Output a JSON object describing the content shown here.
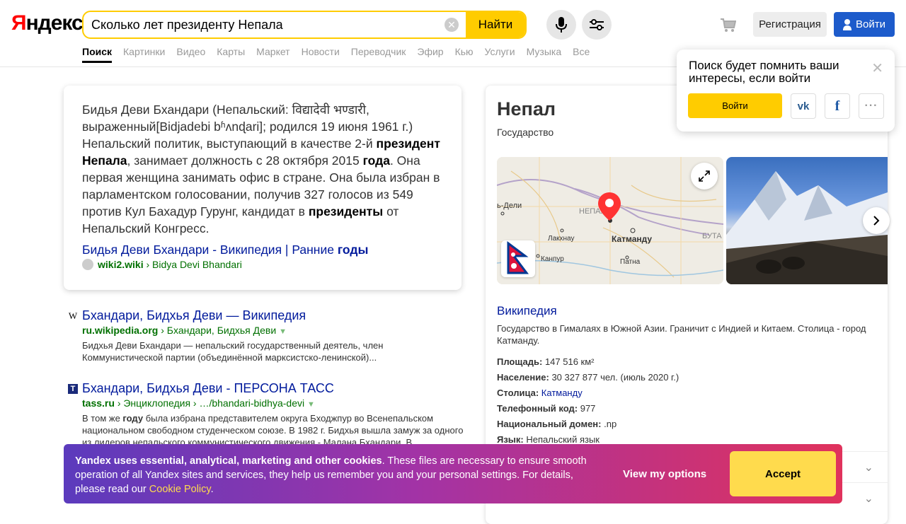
{
  "header": {
    "logo_ya": "Я",
    "logo_rest": "ндекс",
    "search_value": "Сколько лет президенту Непала",
    "find_label": "Найти",
    "register_label": "Регистрация",
    "login_label": "Войти"
  },
  "tabs": [
    "Поиск",
    "Картинки",
    "Видео",
    "Карты",
    "Маркет",
    "Новости",
    "Переводчик",
    "Эфир",
    "Кью",
    "Услуги",
    "Музыка",
    "Все"
  ],
  "snippet": {
    "text_1": "Бидья Деви Бхандари (Непальский: विद्यादेवी भण्डारी, выраженный[Bidjadebi bʱʌnɖari]; родился 19 июня 1961 г.) Непальский политик, выступающий в качестве 2-й ",
    "bold_1": "президент Непала",
    "text_2": ", занимает должность с 28 октября 2015 ",
    "bold_2": "года",
    "text_3": ". Она первая женщина занимать офис в стране. Она была избран в парламентском голосовании, получив 327 голосов из 549 против Кул Бахадур Гурунг, кандидат в ",
    "bold_3": "президенты",
    "text_4": " от Непальский Конгресс.",
    "link_text": "Бидья Деви Бхандари - Википедия | Ранние ",
    "link_bold": "годы",
    "source_domain": "wiki2.wiki",
    "source_path": "› Bidya Devi Bhandari"
  },
  "results": [
    {
      "icon": "W",
      "title": "Бхандари, Бидхья Деви — Википедия",
      "domain": "ru.wikipedia.org",
      "path": "› Бхандари, Бидхья Деви",
      "desc": "Бидхья Деви Бхандари — непальский государственный деятель, член Коммунистической партии (объединённой марксистско-ленинской)..."
    },
    {
      "icon": "T",
      "title": "Бхандари, Бидхья Деви - ПЕРСОНА ТАСС",
      "domain": "tass.ru",
      "path": "› Энциклопедия › …/bhandari-bidhya-devi",
      "desc_1": "В том же ",
      "desc_bold": "году",
      "desc_2": " была избрана представителем округа Бходжпур во Всенепальском национальном свободном студенческом союзе. В 1982 г. Бидхья вышла замуж за одного из лидеров непальского коммунистического движения - Малана Бхандари. В..."
    }
  ],
  "knowledge_panel": {
    "title": "Непал",
    "subtitle": "Государство",
    "map_labels": {
      "delhi": "ь-Дели",
      "nepal": "НЕПАЛ",
      "lucknow": "Лакхнау",
      "kathmandu": "Катманду",
      "kanpur": "Канпур",
      "patna": "Патна",
      "bhutan": "БУТА"
    },
    "wiki_title": "Википедия",
    "wiki_desc": "Государство в Гималаях в Южной Азии. Граничит с Индией и Китаем. Столица - город Катманду.",
    "facts": [
      {
        "key": "Площадь:",
        "value": "147 516 км²"
      },
      {
        "key": "Население:",
        "value": "30 327 877 чел. (июль 2020 г.)"
      },
      {
        "key": "Столица:",
        "value": "Катманду"
      },
      {
        "key": "Телефонный код:",
        "value": "977"
      },
      {
        "key": "Национальный домен:",
        "value": ".np"
      },
      {
        "key": "Язык:",
        "value": "Непальский язык"
      }
    ]
  },
  "popup": {
    "text": "Поиск будет помнить ваши интересы, если войти",
    "login_label": "Войти"
  },
  "cookie": {
    "bold": "Yandex uses essential, analytical, marketing and other cookies",
    "text": ". These files are necessary to ensure smooth operation of all Yandex sites and services, they help us remember you and your personal settings. For details, please read our ",
    "policy_link": "Cookie Policy",
    "tail": ".",
    "options_label": "View my options",
    "accept_label": "Accept"
  }
}
